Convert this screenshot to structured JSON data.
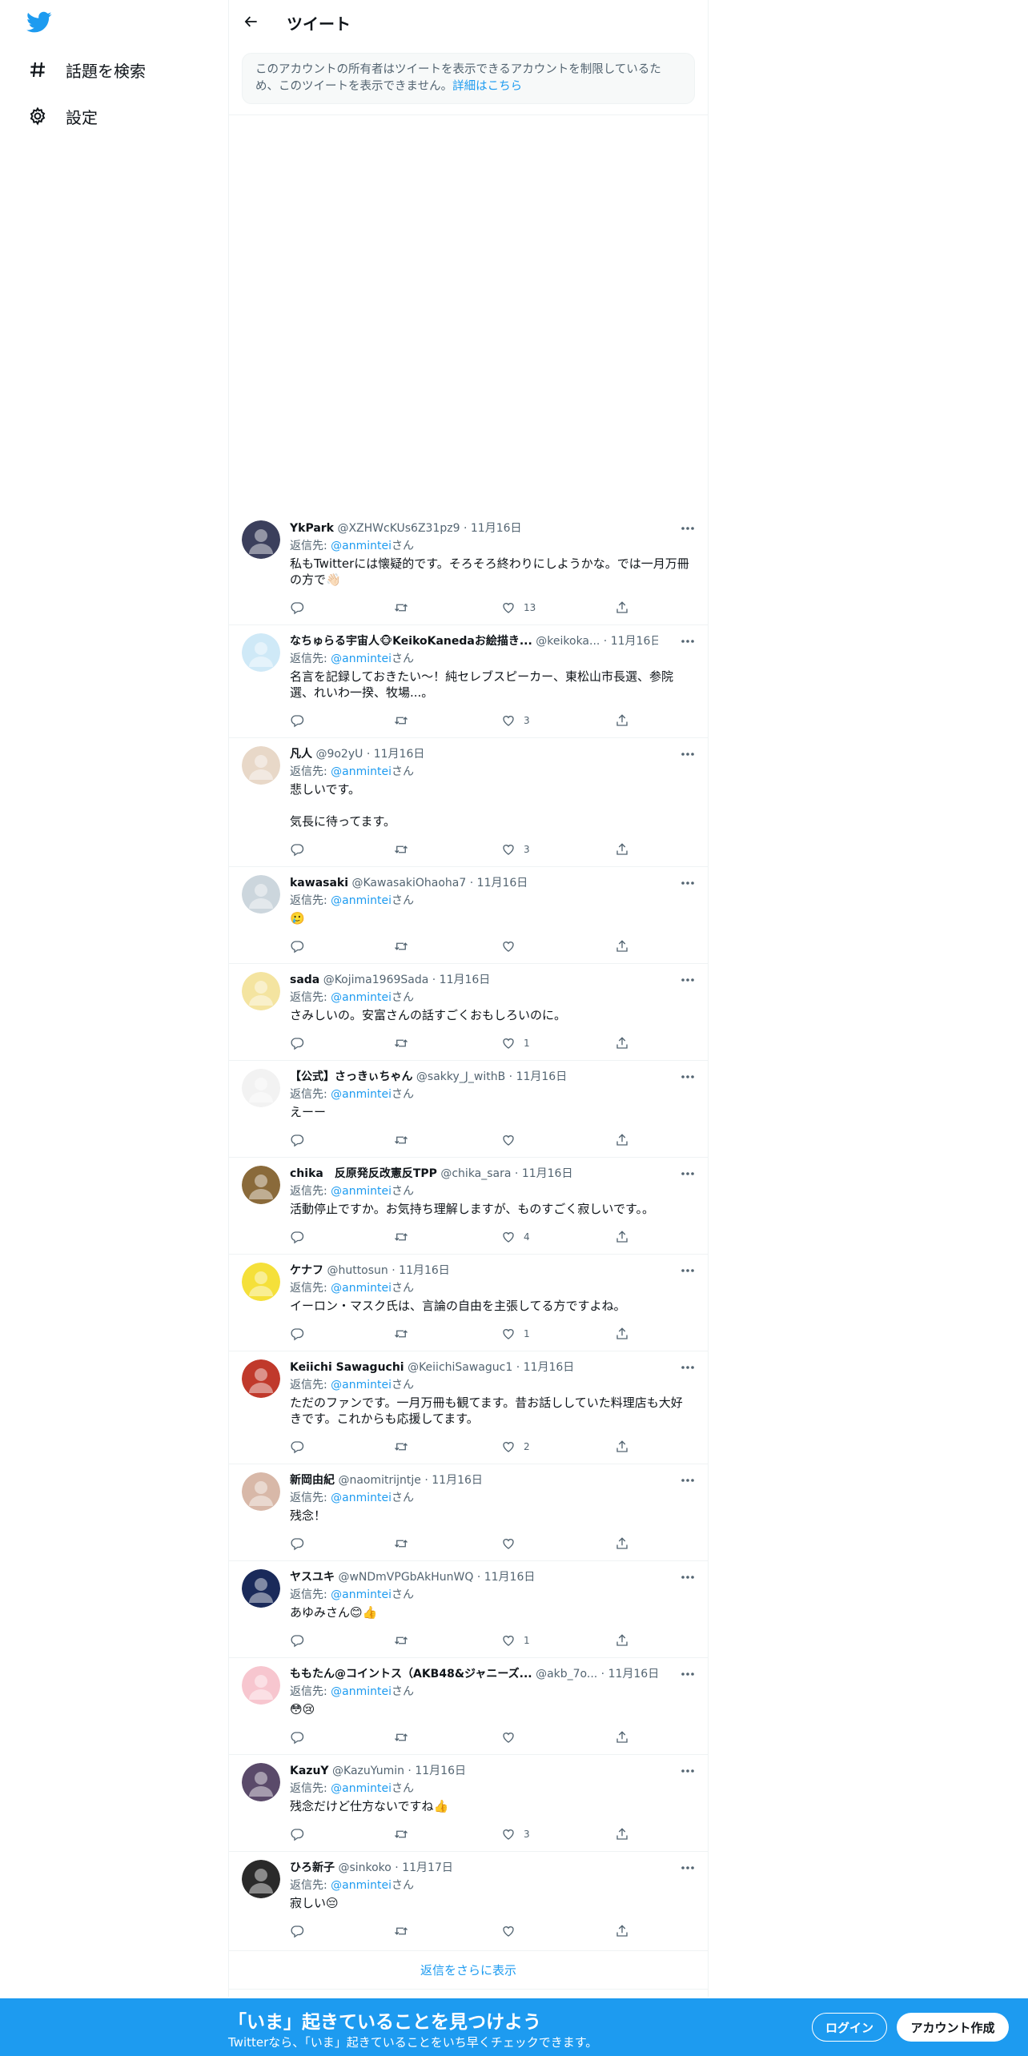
{
  "sidebar": {
    "logo_icon": "twitter-bird-icon",
    "items": [
      {
        "label": "話題を検索",
        "icon": "hashtag-icon"
      },
      {
        "label": "設定",
        "icon": "gear-icon"
      }
    ]
  },
  "header": {
    "title": "ツイート",
    "back_icon": "arrow-left-icon"
  },
  "notice": {
    "text": "このアカウントの所有者はツイートを表示できるアカウントを制限しているため、このツイートを表示できません。",
    "link": "詳細はこちら"
  },
  "reply_prefix": "返信先: ",
  "reply_suffix": "さん",
  "tweets": [
    {
      "name": "YkPark",
      "handle": "@XZHWcKUs6Z31pz9",
      "date": "11月16日",
      "to": "@anmintei",
      "text": "私もTwitterには懐疑的です。そろそろ終わりにしようかな。では一月万冊の方で👋🏻",
      "likes": "13",
      "avatar_color": "#3b3f5c"
    },
    {
      "name": "なちゅらる宇宙人🐵KeikoKanedaお絵描き...",
      "handle": "@keikoka...",
      "date": "11月16日",
      "to": "@anmintei",
      "text": "名言を記録しておきたい〜！純セレブスピーカー、東松山市長選、参院選、れいわ一揆、牧場...。",
      "likes": "3",
      "avatar_color": "#cfe9f7"
    },
    {
      "name": "凡人",
      "handle": "@9o2yU",
      "date": "11月16日",
      "to": "@anmintei",
      "text": "悲しいです。\n\n気長に待ってます。",
      "likes": "3",
      "avatar_color": "#e8d8c8"
    },
    {
      "name": "kawasaki",
      "handle": "@KawasakiOhaoha7",
      "date": "11月16日",
      "to": "@anmintei",
      "text": "🥲",
      "likes": "",
      "avatar_color": "#ccd6dd"
    },
    {
      "name": "sada",
      "handle": "@Kojima1969Sada",
      "date": "11月16日",
      "to": "@anmintei",
      "text": "さみしいの。安富さんの話すごくおもしろいのに。",
      "likes": "1",
      "avatar_color": "#f4e4a0"
    },
    {
      "name": "【公式】さっきぃちゃん",
      "handle": "@sakky_J_withB",
      "date": "11月16日",
      "to": "@anmintei",
      "text": "えーー",
      "likes": "",
      "avatar_color": "#f2f2f2"
    },
    {
      "name": "chika　反原発反改憲反TPP",
      "handle": "@chika_sara",
      "date": "11月16日",
      "to": "@anmintei",
      "text": "活動停止ですか。お気持ち理解しますが、ものすごく寂しいです。。",
      "likes": "4",
      "avatar_color": "#8a6a3a"
    },
    {
      "name": "ケナフ",
      "handle": "@huttosun",
      "date": "11月16日",
      "to": "@anmintei",
      "text": "イーロン・マスク氏は、言論の自由を主張してる方ですよね。",
      "likes": "1",
      "avatar_color": "#f5e03a"
    },
    {
      "name": "Keiichi Sawaguchi",
      "handle": "@KeiichiSawaguc1",
      "date": "11月16日",
      "to": "@anmintei",
      "text": "ただのファンです。一月万冊も観てます。昔お話ししていた料理店も大好きです。これからも応援してます。",
      "likes": "2",
      "avatar_color": "#c0392b"
    },
    {
      "name": "新岡由紀",
      "handle": "@naomitrijntje",
      "date": "11月16日",
      "to": "@anmintei",
      "text": "残念！",
      "likes": "",
      "avatar_color": "#d8b8a8"
    },
    {
      "name": "ヤスユキ",
      "handle": "@wNDmVPGbAkHunWQ",
      "date": "11月16日",
      "to": "@anmintei",
      "text": "あゆみさん😊👍",
      "likes": "1",
      "avatar_color": "#1a2a5a"
    },
    {
      "name": "ももたん@コイントス（AKB48&ジャニーズ...",
      "handle": "@akb_7o...",
      "date": "11月16日",
      "to": "@anmintei",
      "text": "😳😢",
      "likes": "",
      "avatar_color": "#f7c6cf"
    },
    {
      "name": "KazuY",
      "handle": "@KazuYumin",
      "date": "11月16日",
      "to": "@anmintei",
      "text": "残念だけど仕方ないですね👍",
      "likes": "3",
      "avatar_color": "#5a4a6a"
    },
    {
      "name": "ひろ新子",
      "handle": "@sinkoko",
      "date": "11月17日",
      "to": "@anmintei",
      "text": "寂しい😔",
      "likes": "",
      "avatar_color": "#2a2a2a"
    }
  ],
  "show_more": "返信をさらに表示",
  "bottom_bar": {
    "title": "「いま」起きていることを見つけよう",
    "subtitle": "Twitterなら、「いま」起きていることをいち早くチェックできます。",
    "login": "ログイン",
    "signup": "アカウント作成"
  },
  "colors": {
    "accent": "#1d9bf0",
    "text": "#0f1419",
    "muted": "#536471",
    "border": "#eff3f4"
  }
}
